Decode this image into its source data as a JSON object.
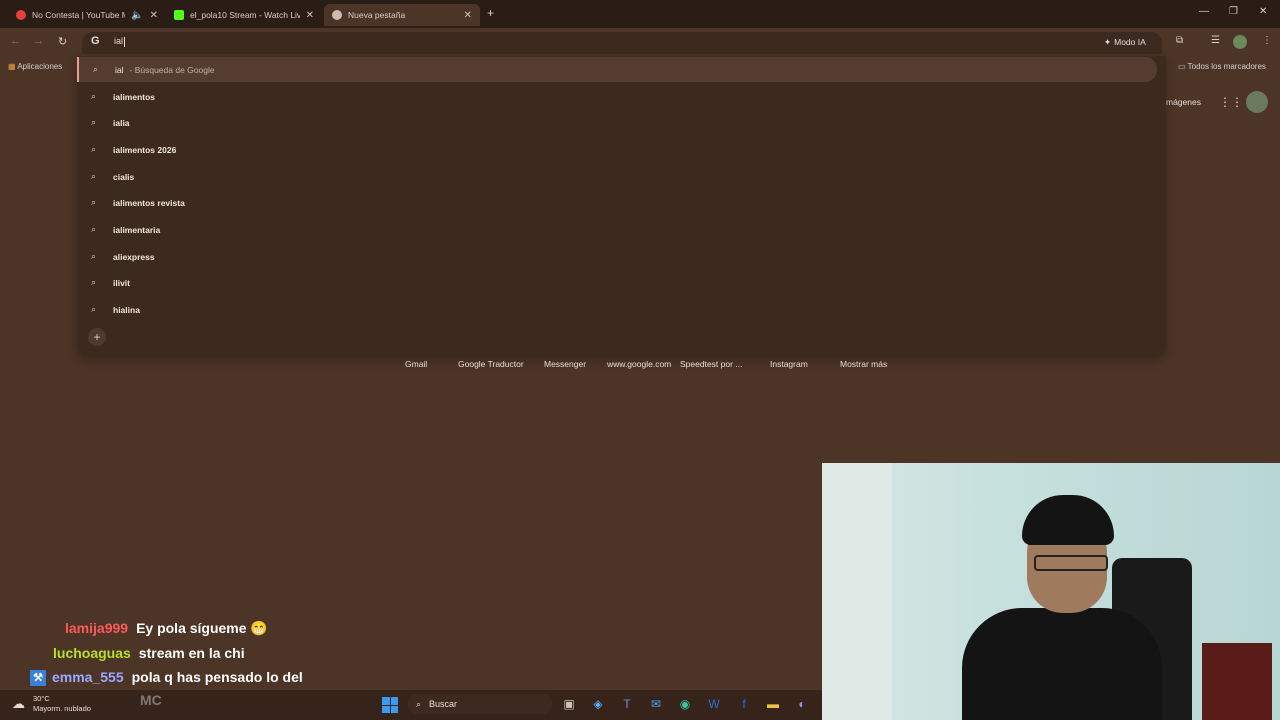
{
  "tabs": [
    {
      "title": "No Contesta | YouTube Mu",
      "color": "#e0433e",
      "muted": "🔈"
    },
    {
      "title": "el_pola10 Stream - Watch Live",
      "color": "#53fc18"
    },
    {
      "title": "Nueva pestaña",
      "color": "#c9bcb3"
    }
  ],
  "toolbar": {
    "omnibox_text": "ial",
    "mode_ia_label": "Modo IA"
  },
  "bookmarks": {
    "apps_label": "Aplicaciones",
    "all_label": "Todos los marcadores"
  },
  "suggestions": {
    "first": {
      "text": "ial",
      "sub": "-  Búsqueda de Google"
    },
    "items": [
      "ialimentos",
      "ialia",
      "ialimentos 2026",
      "cialis",
      "ialimentos revista",
      "ialimentaria",
      "aliexpress",
      "ilivit",
      "hialina"
    ]
  },
  "header": {
    "imagenes_label": "mágenes"
  },
  "shortcuts": [
    "Gmail",
    "Google Traductor",
    "Messenger",
    "www.google.com",
    "Speedtest por ...",
    "Instagram",
    "Mostrar más"
  ],
  "chat": [
    {
      "user": "lamija999",
      "color": "#ff5a5a",
      "message": "Ey pola sígueme 😁"
    },
    {
      "user": "luchoaguas",
      "color": "#b6e02a",
      "message": "stream en la chi"
    },
    {
      "user": "emma_555",
      "color": "#9aa8ff",
      "message": "pola q has pensado lo del"
    },
    {
      "user": "",
      "color": "#ffffff",
      "message": "MC"
    }
  ],
  "taskbar": {
    "temp": "30°C",
    "weather": "Mayorm. nublado",
    "search_label": "Buscar"
  }
}
